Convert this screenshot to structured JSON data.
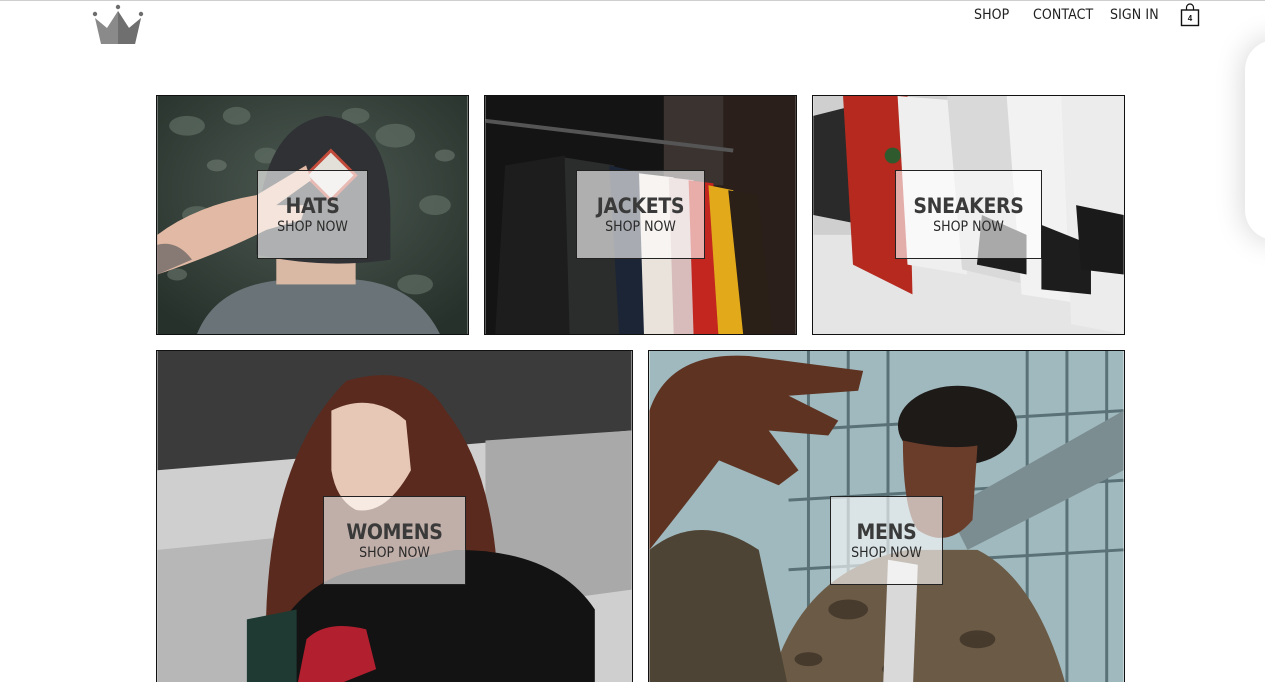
{
  "header": {
    "nav": [
      {
        "label": "SHOP"
      },
      {
        "label": "CONTACT"
      },
      {
        "label": "SIGN IN"
      }
    ],
    "cart": {
      "count": "4",
      "icon": "shopping-bag-icon"
    },
    "logo": {
      "icon": "crown-icon"
    }
  },
  "categories": [
    {
      "title": "HATS",
      "cta": "SHOP NOW"
    },
    {
      "title": "JACKETS",
      "cta": "SHOP NOW"
    },
    {
      "title": "SNEAKERS",
      "cta": "SHOP NOW"
    },
    {
      "title": "WOMENS",
      "cta": "SHOP NOW"
    },
    {
      "title": "MENS",
      "cta": "SHOP NOW"
    }
  ],
  "colors": {
    "border": "#111111",
    "label_bg": "rgba(255,255,255,0.62)",
    "text": "#3a3a3a"
  }
}
